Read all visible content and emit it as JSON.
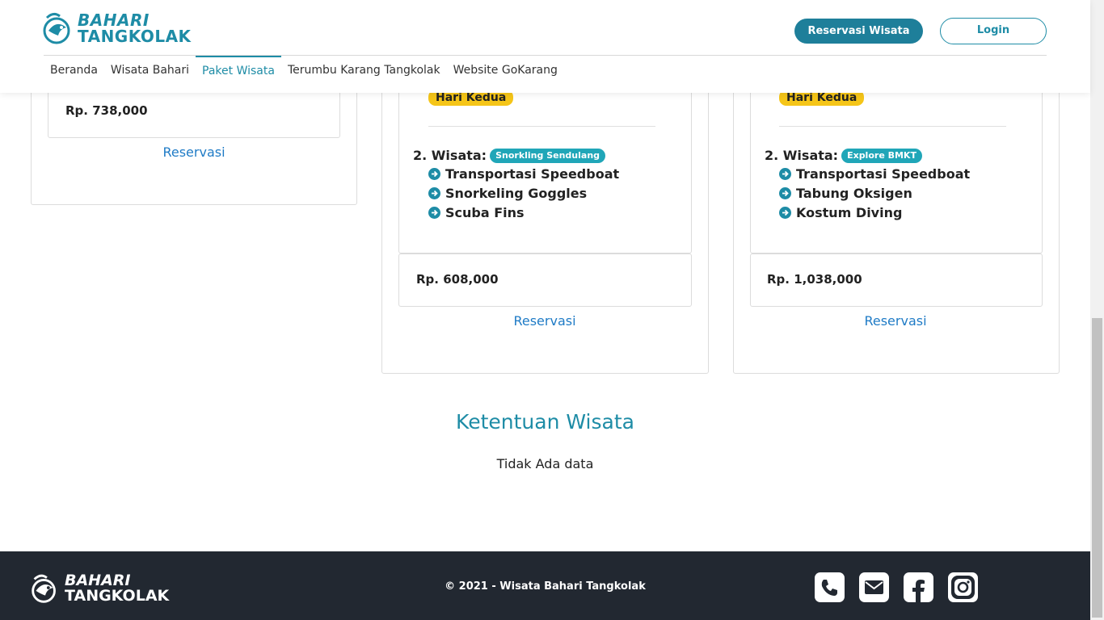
{
  "header": {
    "logo_line1": "BAHARI",
    "logo_line2": "TANGKOLAK",
    "reservation_button": "Reservasi Wisata",
    "login_button": "Login",
    "nav": [
      {
        "label": "Beranda"
      },
      {
        "label": "Wisata Bahari"
      },
      {
        "label": "Paket Wisata",
        "active": true
      },
      {
        "label": "Terumbu Karang Tangkolak"
      },
      {
        "label": "Website GoKarang"
      }
    ]
  },
  "packages": [
    {
      "price": "Rp. 738,000",
      "reserve_label": "Reservasi"
    },
    {
      "day_badge": "Hari Kedua",
      "wisata_prefix": "2. Wisata:",
      "wisata_name": "Snorkling Sendulang",
      "items": [
        "Transportasi Speedboat",
        "Snorkeling Goggles",
        "Scuba Fins"
      ],
      "price": "Rp. 608,000",
      "reserve_label": "Reservasi"
    },
    {
      "day_badge": "Hari Kedua",
      "wisata_prefix": "2. Wisata:",
      "wisata_name": "Explore BMKT",
      "items": [
        "Transportasi Speedboat",
        "Tabung Oksigen",
        "Kostum Diving"
      ],
      "price": "Rp. 1,038,000",
      "reserve_label": "Reservasi"
    }
  ],
  "ketentuan": {
    "title": "Ketentuan Wisata",
    "empty_text": "Tidak Ada data"
  },
  "footer": {
    "logo_line1": "BAHARI",
    "logo_line2": "TANGKOLAK",
    "copyright": "© 2021 - Wisata Bahari Tangkolak",
    "social_icons": [
      "phone-icon",
      "email-icon",
      "facebook-icon",
      "instagram-icon"
    ]
  },
  "colors": {
    "primary": "#1e8ca6",
    "button_fill": "#1e7f9a",
    "day_badge": "#f5c518",
    "tour_badge": "#20a6b8",
    "link": "#1f7bc6",
    "footer_bg": "#222831"
  }
}
